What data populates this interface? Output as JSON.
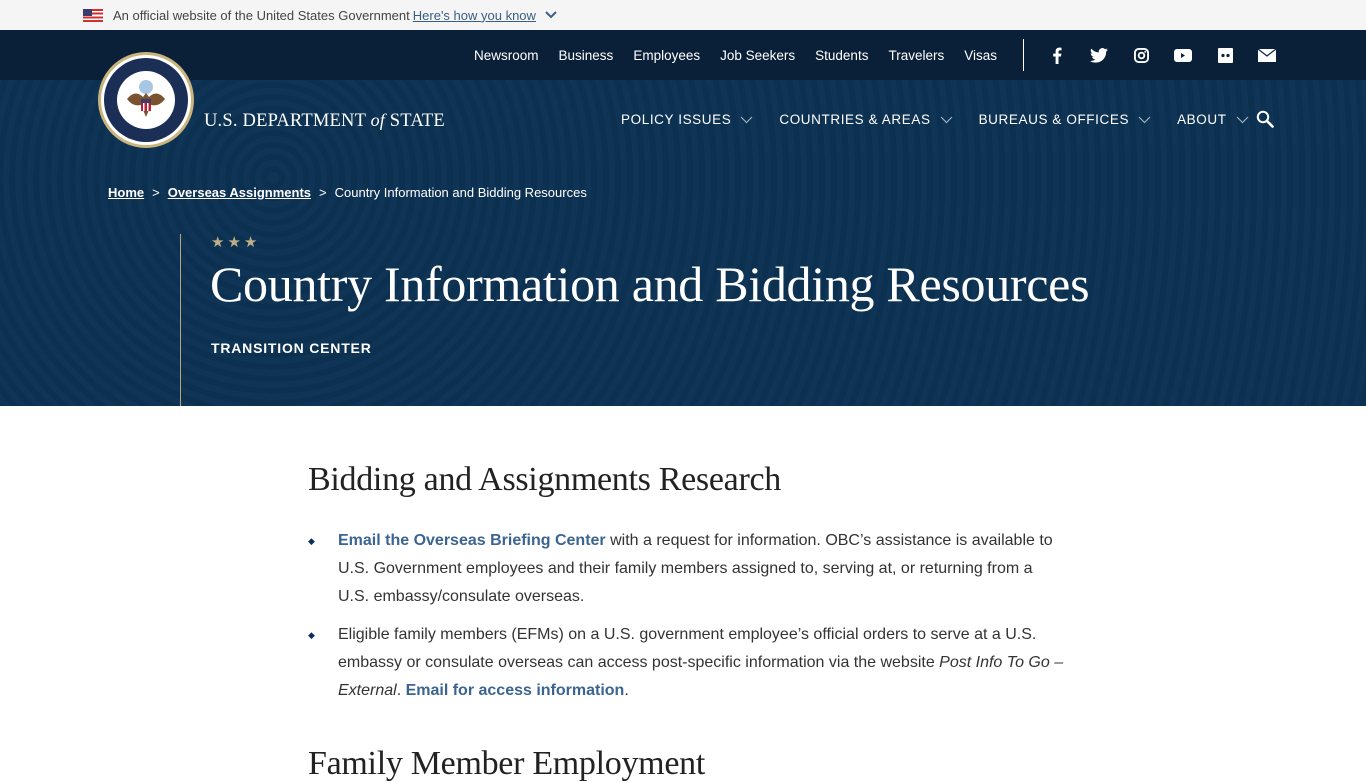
{
  "gov_banner": {
    "text": "An official website of the United States Government",
    "link": "Here's how you know"
  },
  "utility_nav": {
    "links": [
      "Newsroom",
      "Business",
      "Employees",
      "Job Seekers",
      "Students",
      "Travelers",
      "Visas"
    ],
    "social": [
      "facebook-icon",
      "twitter-icon",
      "instagram-icon",
      "youtube-icon",
      "flickr-icon",
      "email-icon"
    ]
  },
  "brand": {
    "wordmark_pre": "U.S. DEPARTMENT ",
    "wordmark_of": "of",
    "wordmark_post": " STATE"
  },
  "primary_nav": {
    "items": [
      "POLICY ISSUES",
      "COUNTRIES & AREAS",
      "BUREAUS & OFFICES",
      "ABOUT"
    ]
  },
  "breadcrumb": {
    "home": "Home",
    "parent": "Overseas Assignments",
    "current": "Country Information and Bidding Resources",
    "separator": ">"
  },
  "hero": {
    "stars": "★★★",
    "title": "Country Information and Bidding Resources",
    "label": "TRANSITION CENTER"
  },
  "content": {
    "section1_title": "Bidding and Assignments Research",
    "bullet1": {
      "link": "Email the Overseas Briefing Center",
      "text": " with a request for information.  OBC’s assistance is available to U.S. Government employees and their family members assigned to, serving at, or returning from a U.S. embassy/consulate overseas."
    },
    "bullet2": {
      "text": "Eligible family members (EFMs) on a U.S. government employee’s official orders to serve at a U.S. embassy or consulate overseas can access post-specific information via the website ",
      "italic": "Post Info To Go – External",
      "text2": ".  ",
      "link": "Email for access information",
      "text3": "."
    },
    "section2_title": "Family Member Employment"
  },
  "colors": {
    "banner_bg": "#f5f5f5",
    "utility_bg": "#0a2038",
    "hero_bg": "#0c3152",
    "accent_gold": "#bfae88",
    "link_blue": "#3b6590"
  }
}
